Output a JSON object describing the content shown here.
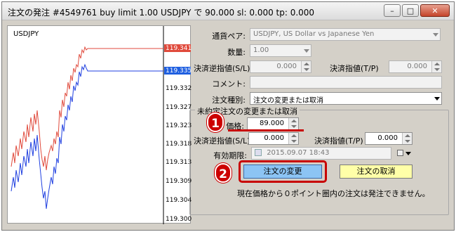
{
  "window": {
    "title": "注文の発注 #4549761 buy limit 1.00 USDJPY で 90.000 sl: 0.000 tp: 0.000",
    "buttons": {
      "minimize": "–",
      "maximize": "□",
      "close": "✕"
    }
  },
  "chart": {
    "symbol": "USDJPY",
    "price_ticks": [
      "119.341",
      "119.335",
      "119.332",
      "119.327",
      "119.323",
      "119.318",
      "119.313",
      "119.309",
      "119.304",
      "119.300"
    ],
    "bid_label": "119.341",
    "ask_label": "119.335",
    "colors": {
      "bid": "#e04a3c",
      "ask": "#1f3fe0",
      "bid_tag": "#e04a3c",
      "ask_tag": "#1f5fe0"
    }
  },
  "form": {
    "currency_pair": {
      "label": "通貨ペア:",
      "value": "USDJPY, US Dollar vs Japanese Yen"
    },
    "quantity": {
      "label": "数量:",
      "value": "1.00"
    },
    "stop_loss": {
      "label": "決済逆指値(S/L)",
      "value": "0.000"
    },
    "take_profit": {
      "label": "決済指値(T/P)",
      "value": "0.000"
    },
    "comment": {
      "label": "コメント:",
      "value": ""
    },
    "order_type": {
      "label": "注文種別:",
      "value": "注文の変更または取消"
    }
  },
  "pending": {
    "group_title": "未約定注文の変更または取消",
    "price": {
      "label": "価格:",
      "value": "89.000"
    },
    "stop_loss": {
      "label": "決済逆指値(S/L)",
      "value": "0.000"
    },
    "take_profit": {
      "label": "決済指値(T/P)",
      "value": "0.000"
    },
    "expiry": {
      "label": "有効期限:",
      "value": "2015.09.07 18:43"
    },
    "modify_button": "注文の変更",
    "cancel_button": "注文の取消",
    "note": "現在価格から０ポイント圏内の注文は発注できません。"
  },
  "annotations": {
    "marker1": "1",
    "marker2": "2"
  }
}
